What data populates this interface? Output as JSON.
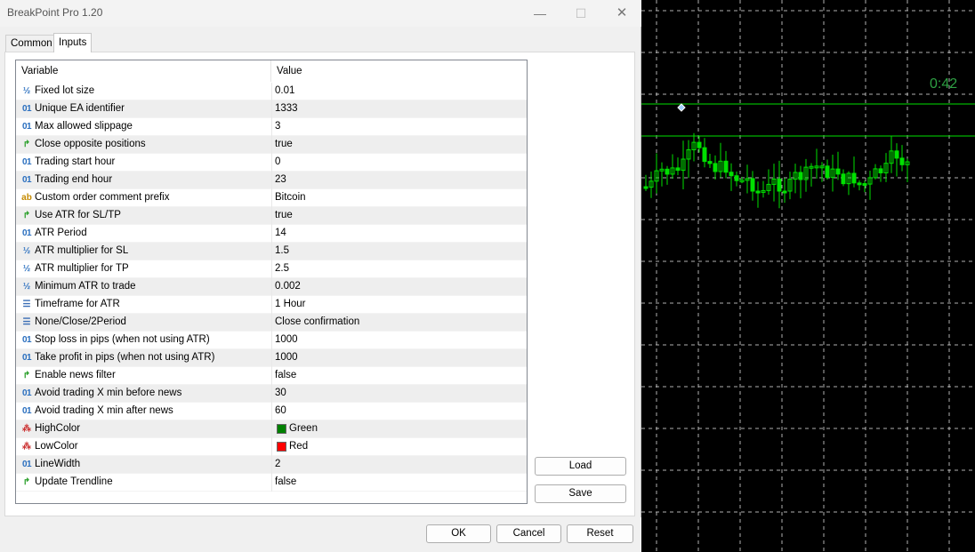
{
  "window": {
    "title": "BreakPoint Pro 1.20"
  },
  "tabs": [
    {
      "label": "Common"
    },
    {
      "label": "Inputs"
    }
  ],
  "grid": {
    "columns": {
      "variable": "Variable",
      "value": "Value"
    },
    "rows": [
      {
        "type": "double",
        "icon": "½",
        "variable": "Fixed lot size",
        "value": "0.01"
      },
      {
        "type": "int",
        "icon": "01",
        "variable": "Unique EA identifier",
        "value": "1333"
      },
      {
        "type": "int",
        "icon": "01",
        "variable": "Max allowed slippage",
        "value": "3"
      },
      {
        "type": "bool",
        "icon": "↱",
        "variable": "Close opposite positions",
        "value": "true"
      },
      {
        "type": "int",
        "icon": "01",
        "variable": "Trading start hour",
        "value": "0"
      },
      {
        "type": "int",
        "icon": "01",
        "variable": "Trading end hour",
        "value": "23"
      },
      {
        "type": "string",
        "icon": "ab",
        "variable": "Custom order comment prefix",
        "value": "Bitcoin"
      },
      {
        "type": "bool",
        "icon": "↱",
        "variable": "Use ATR for SL/TP",
        "value": "true"
      },
      {
        "type": "int",
        "icon": "01",
        "variable": "ATR Period",
        "value": "14"
      },
      {
        "type": "double",
        "icon": "½",
        "variable": "ATR multiplier for SL",
        "value": "1.5"
      },
      {
        "type": "double",
        "icon": "½",
        "variable": "ATR multiplier for TP",
        "value": "2.5"
      },
      {
        "type": "double",
        "icon": "½",
        "variable": "Minimum ATR to trade",
        "value": "0.002"
      },
      {
        "type": "enum",
        "icon": "☰",
        "variable": "Timeframe for ATR",
        "value": "1 Hour"
      },
      {
        "type": "enum",
        "icon": "☰",
        "variable": "None/Close/2Period",
        "value": "Close confirmation"
      },
      {
        "type": "int",
        "icon": "01",
        "variable": "Stop loss in pips (when not using ATR)",
        "value": "1000"
      },
      {
        "type": "int",
        "icon": "01",
        "variable": "Take profit in pips (when not using ATR)",
        "value": "1000"
      },
      {
        "type": "bool",
        "icon": "↱",
        "variable": "Enable news filter",
        "value": "false"
      },
      {
        "type": "int",
        "icon": "01",
        "variable": "Avoid trading X min before news",
        "value": "30"
      },
      {
        "type": "int",
        "icon": "01",
        "variable": "Avoid trading X min after news",
        "value": "60"
      },
      {
        "type": "color",
        "icon": "⁂",
        "variable": "HighColor",
        "value": "Green",
        "swatch": "#008000"
      },
      {
        "type": "color",
        "icon": "⁂",
        "variable": "LowColor",
        "value": "Red",
        "swatch": "#ff0000"
      },
      {
        "type": "int",
        "icon": "01",
        "variable": "LineWidth",
        "value": "2"
      },
      {
        "type": "bool",
        "icon": "↱",
        "variable": "Update Trendline",
        "value": "false"
      }
    ]
  },
  "buttons": {
    "load": "Load",
    "save": "Save",
    "ok": "OK",
    "cancel": "Cancel",
    "reset": "Reset"
  },
  "chart": {
    "timer": "0:42",
    "candle_color": "#00e000",
    "background": "#000000",
    "grid_color": "#cfcfcf"
  }
}
